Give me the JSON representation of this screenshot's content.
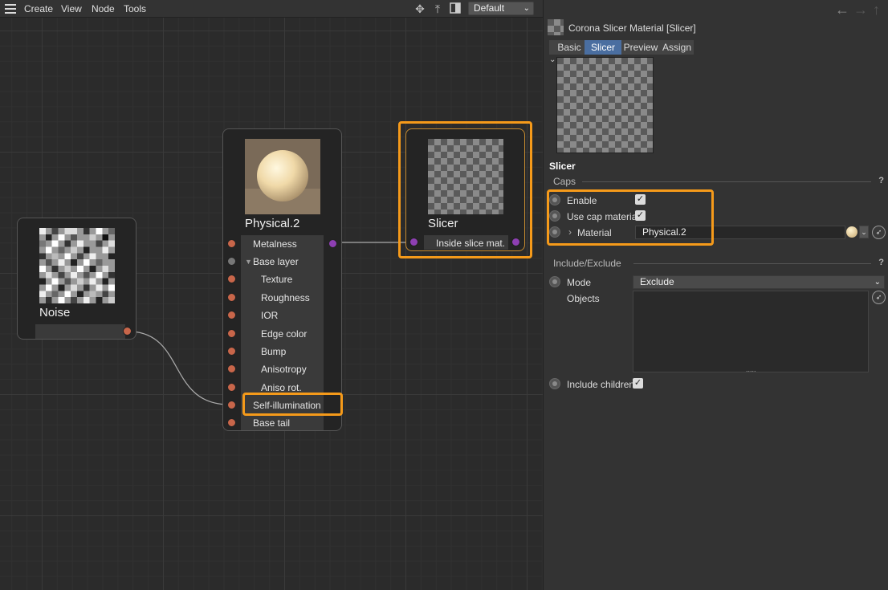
{
  "menu": {
    "create": "Create",
    "view": "View",
    "node": "Node",
    "tools": "Tools"
  },
  "toolbar": {
    "icons": [
      "move-icon",
      "pin-icon",
      "panel-toggle-icon"
    ],
    "layout_value": "Default"
  },
  "nodes": {
    "noise": {
      "title": "Noise"
    },
    "physical": {
      "title": "Physical.2",
      "ports": [
        "Metalness",
        "Base layer",
        "Texture",
        "Roughness",
        "IOR",
        "Edge color",
        "Bump",
        "Anisotropy",
        "Aniso rot.",
        "Self-illumination",
        "Base tail"
      ]
    },
    "slicer": {
      "title": "Slicer",
      "port": "Inside slice mat."
    }
  },
  "panel": {
    "title": "Corona Slicer Material [Slicer]",
    "tabs": [
      "Basic",
      "Slicer",
      "Preview",
      "Assign"
    ],
    "active_tab": "Slicer",
    "section": "Slicer",
    "caps": {
      "heading": "Caps",
      "help": "?",
      "enable_label": "Enable",
      "enable_checked": true,
      "use_cap_label": "Use cap material",
      "use_cap_checked": true,
      "material_label": "Material",
      "material_value": "Physical.2"
    },
    "include_exclude": {
      "heading": "Include/Exclude",
      "help": "?",
      "mode_label": "Mode",
      "mode_value": "Exclude",
      "objects_label": "Objects",
      "include_children_label": "Include children",
      "include_children_checked": true
    }
  },
  "colors": {
    "highlight": "#f59a1a",
    "active_tab": "#4a6ea0",
    "port_orange": "#c8664a",
    "port_purple": "#8e3fb3"
  }
}
